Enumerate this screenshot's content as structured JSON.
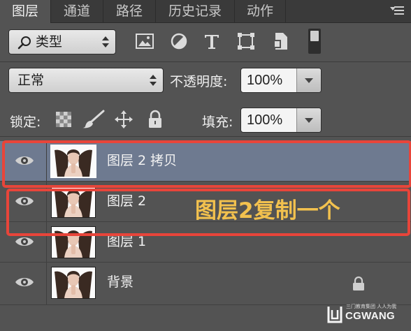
{
  "tabs": [
    "图层",
    "通道",
    "路径",
    "历史记录",
    "动作"
  ],
  "filter": {
    "kind_label": "类型",
    "icons": [
      "image-filter-icon",
      "adjustment-filter-icon",
      "type-filter-icon",
      "shape-filter-icon",
      "smart-object-filter-icon",
      "filter-toggle-icon"
    ]
  },
  "blend": {
    "mode": "正常",
    "opacity_label": "不透明度:",
    "opacity_value": "100%"
  },
  "lock": {
    "label": "锁定:",
    "fill_label": "填充:",
    "fill_value": "100%",
    "icons": [
      "lock-transparent-pixels-icon",
      "lock-image-pixels-icon",
      "lock-position-icon",
      "lock-all-icon"
    ]
  },
  "layers": [
    {
      "name": "图层 2 拷贝",
      "selected": true,
      "visible": true,
      "locked": false
    },
    {
      "name": "图层 2",
      "selected": false,
      "visible": true,
      "locked": false
    },
    {
      "name": "图层 1",
      "selected": false,
      "visible": true,
      "locked": false
    },
    {
      "name": "背景",
      "selected": false,
      "visible": true,
      "locked": true
    }
  ],
  "annotation": {
    "text": "图层2复制一个",
    "highlight_color": "#e8453a",
    "text_color": "#f2c14e"
  },
  "watermark": {
    "text": "CGWANG",
    "small_text": "三门教育集团 人人为我"
  }
}
